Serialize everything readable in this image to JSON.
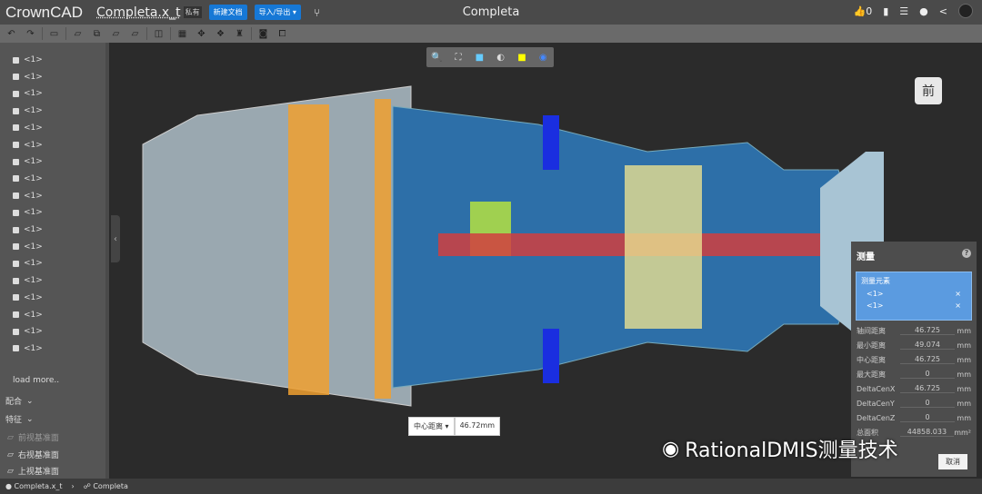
{
  "app": {
    "logo": "CrownCAD",
    "document": "Completa.x_t",
    "privacy_tag": "私有",
    "new_doc": "新建文档",
    "import_export": "导入/导出 ▾",
    "window_title": "Completa",
    "likes": "0"
  },
  "sidebar": {
    "items": [
      "<1>",
      "<1>",
      "<1>",
      "<1>",
      "<1>",
      "<1>",
      "<1>",
      "<1>",
      "<1>",
      "<1>",
      "<1>",
      "<1>",
      "<1>",
      "<1>",
      "<1>",
      "<1>",
      "<1>",
      "<1>"
    ],
    "load_more": "load more..",
    "mates": "配合",
    "features": "特征",
    "planes": [
      "前视基准面",
      "右视基准面",
      "上视基准面"
    ]
  },
  "viewcube": {
    "face": "前"
  },
  "measure": {
    "title": "测量",
    "selection_title": "测量元素",
    "selected": [
      "<1>",
      "<1>"
    ],
    "rows": [
      {
        "label": "轴间距离",
        "value": "46.725",
        "unit": "mm"
      },
      {
        "label": "最小距离",
        "value": "49.074",
        "unit": "mm"
      },
      {
        "label": "中心距离",
        "value": "46.725",
        "unit": "mm"
      },
      {
        "label": "最大距离",
        "value": "0",
        "unit": "mm"
      },
      {
        "label": "DeltaCenX",
        "value": "46.725",
        "unit": "mm"
      },
      {
        "label": "DeltaCenY",
        "value": "0",
        "unit": "mm"
      },
      {
        "label": "DeltaCenZ",
        "value": "0",
        "unit": "mm"
      },
      {
        "label": "总面积",
        "value": "44858.033",
        "unit": "mm²"
      }
    ],
    "cancel": "取消"
  },
  "tooltip": {
    "type": "中心距离 ▾",
    "value": "46.72mm"
  },
  "statusbar": {
    "file": "Completa.x_t",
    "assembly": "Completa"
  },
  "watermark": "RationalDMIS测量技术",
  "colors": {
    "accent": "#1678d6",
    "selection": "#5b9be0"
  }
}
